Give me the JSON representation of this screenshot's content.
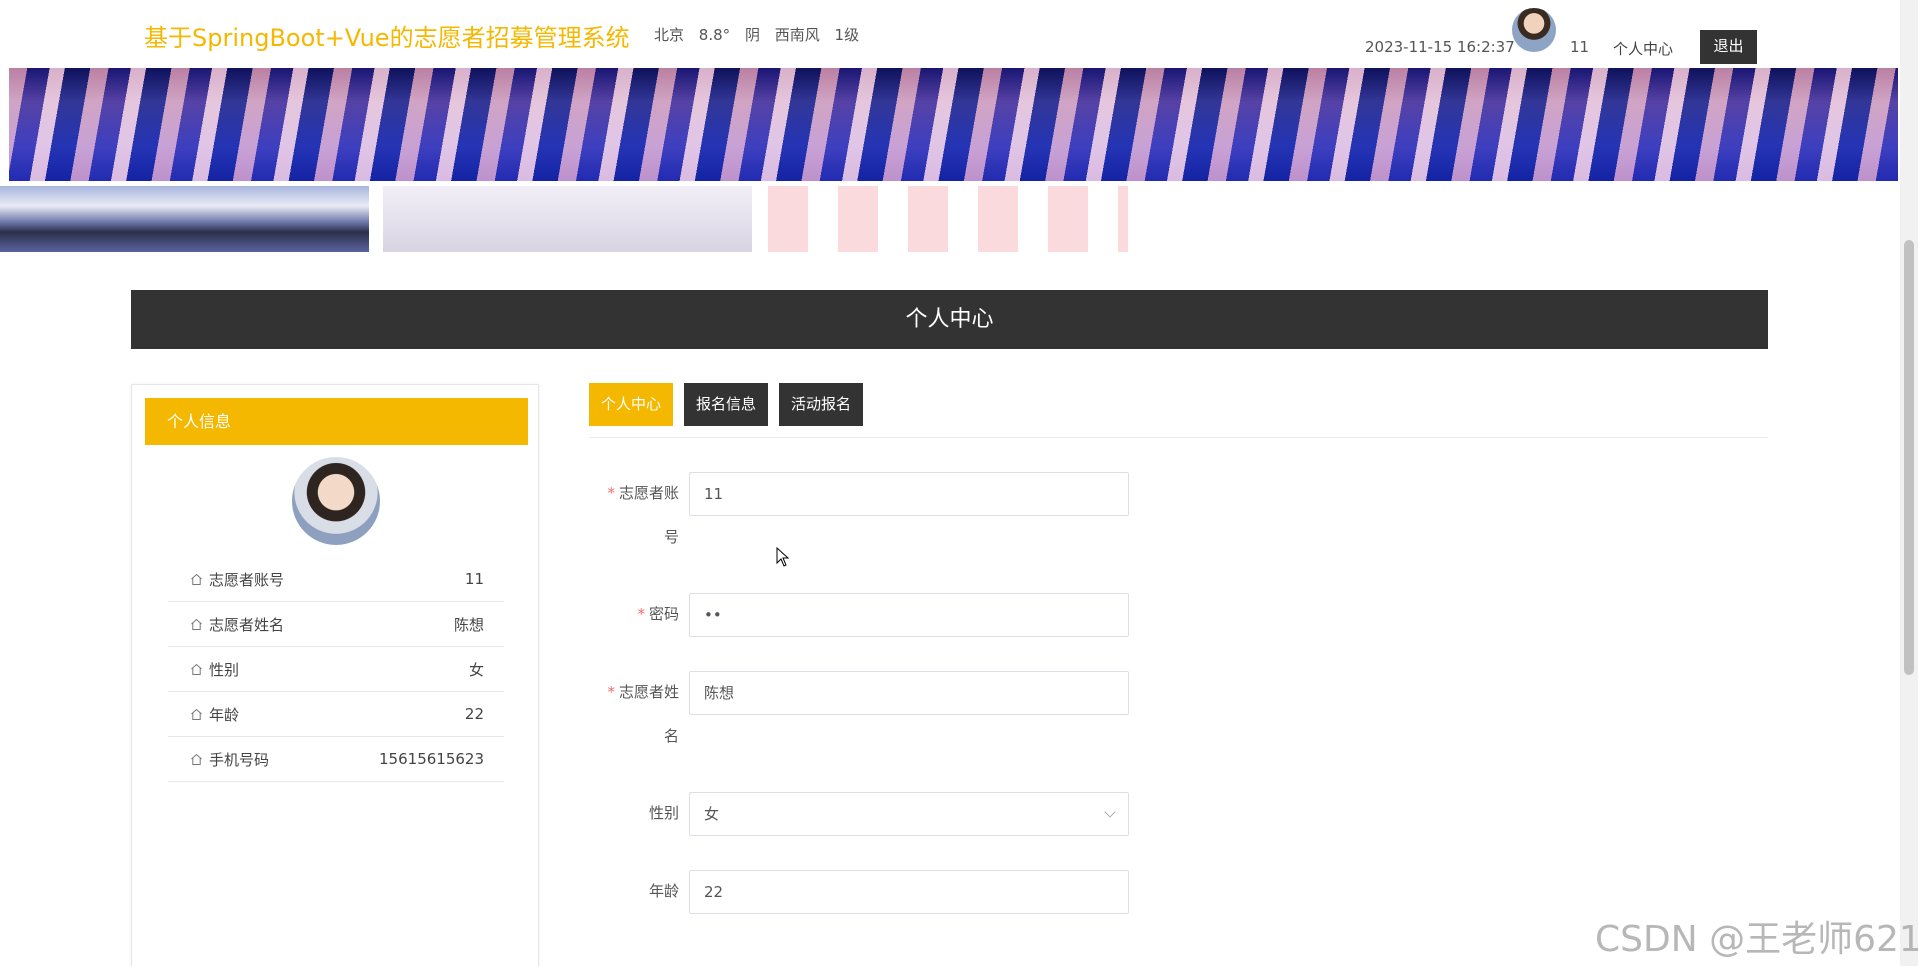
{
  "header": {
    "site_title": "基于SpringBoot+Vue的志愿者招募管理系统",
    "weather": {
      "city": "北京",
      "temperature": "8.8°",
      "condition": "阴",
      "wind": "西南风",
      "wind_level": "1级"
    },
    "datetime": "2023-11-15 16:2:37",
    "username": "11",
    "personal_center_link": "个人中心",
    "logout_label": "退出"
  },
  "section": {
    "title": "个人中心"
  },
  "profile": {
    "panel_title": "个人信息",
    "items": [
      {
        "label": "志愿者账号",
        "value": "11"
      },
      {
        "label": "志愿者姓名",
        "value": "陈想"
      },
      {
        "label": "性别",
        "value": "女"
      },
      {
        "label": "年龄",
        "value": "22"
      },
      {
        "label": "手机号码",
        "value": "15615615623"
      }
    ]
  },
  "tabs": [
    {
      "label": "个人中心",
      "active": true
    },
    {
      "label": "报名信息",
      "active": false
    },
    {
      "label": "活动报名",
      "active": false
    }
  ],
  "form": {
    "account": {
      "label_line1": "志愿者账",
      "label_line2": "号",
      "value": "11",
      "required": true
    },
    "password": {
      "label": "密码",
      "value": "••",
      "required": true
    },
    "name": {
      "label_line1": "志愿者姓",
      "label_line2": "名",
      "value": "陈想",
      "required": true
    },
    "gender": {
      "label": "性别",
      "value": "女"
    },
    "age": {
      "label": "年龄",
      "value": "22"
    }
  },
  "watermark": "CSDN @王老师621",
  "colors": {
    "accent": "#f5b800",
    "dark": "#333333"
  }
}
